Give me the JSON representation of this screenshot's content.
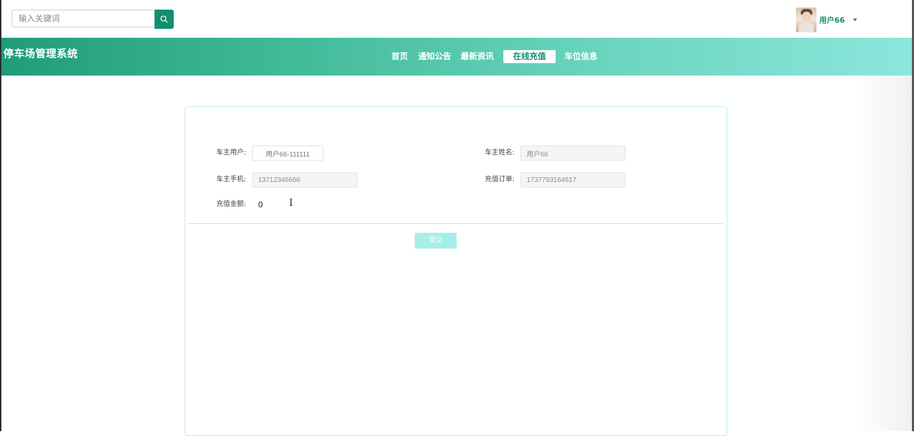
{
  "search": {
    "placeholder": "输入关键词",
    "icon": "search-icon"
  },
  "user": {
    "name": "用户66",
    "avatar": "avatar",
    "menu_icon": "caret-down-icon"
  },
  "site": {
    "title": "停车场管理系统"
  },
  "nav": [
    {
      "label": "首页",
      "active": false
    },
    {
      "label": "通知公告",
      "active": false
    },
    {
      "label": "最新资讯",
      "active": false
    },
    {
      "label": "在线充值",
      "active": true
    },
    {
      "label": "车位信息",
      "active": false
    }
  ],
  "form": {
    "owner_user_label": "车主用户:",
    "owner_user_value": "用户66-111111",
    "owner_name_label": "车主姓名:",
    "owner_name_value": "用户66",
    "owner_phone_label": "车主手机:",
    "owner_phone_value": "13712346666",
    "order_label": "充值订单:",
    "order_value": "1737793164617",
    "amount_label": "充值金额:",
    "amount_value": "0",
    "submit_label": "提交"
  },
  "colors": {
    "primary": "#128f70",
    "nav_gradient_start": "#1f9c78",
    "nav_gradient_end": "#8ce6dc",
    "panel_border": "#b9efe9",
    "submit_bg": "#a6eee9"
  }
}
